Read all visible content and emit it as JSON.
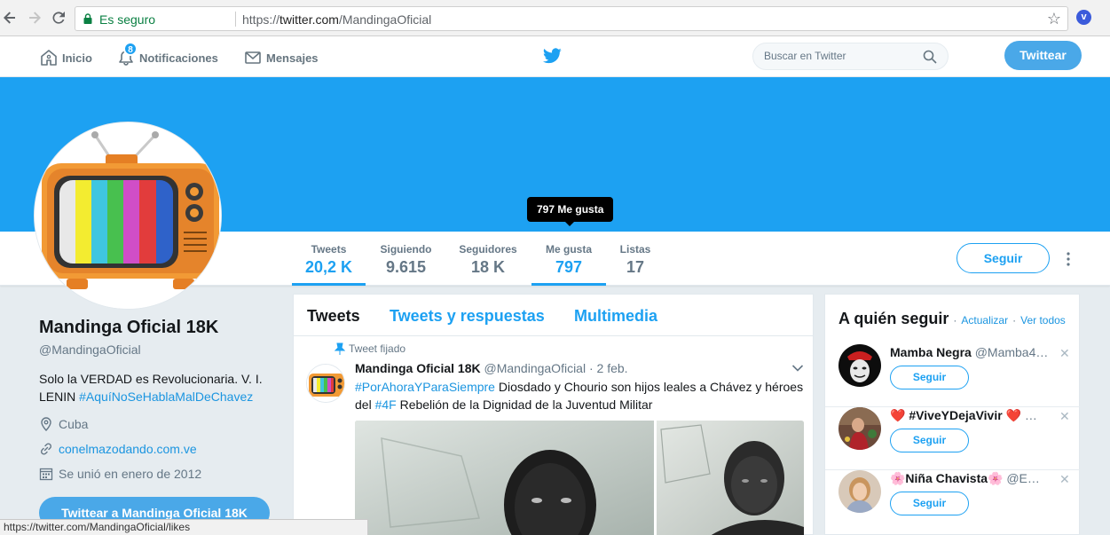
{
  "browser": {
    "secure_label": "Es seguro",
    "url_scheme": "https://",
    "url_host": "twitter.com",
    "url_path": "/MandingaOficial",
    "status_url": "https://twitter.com/MandingaOficial/likes",
    "ext_icon_letter": "v"
  },
  "nav": {
    "home": "Inicio",
    "notifications": "Notificaciones",
    "notifications_count": "8",
    "messages": "Mensajes",
    "search_placeholder": "Buscar en Twitter",
    "tweet_button": "Twittear"
  },
  "stats": [
    {
      "label": "Tweets",
      "value": "20,2 K"
    },
    {
      "label": "Siguiendo",
      "value": "9.615"
    },
    {
      "label": "Seguidores",
      "value": "18 K"
    },
    {
      "label": "Me gusta",
      "value": "797"
    },
    {
      "label": "Listas",
      "value": "17"
    }
  ],
  "tooltip": "797 Me gusta",
  "follow_button": "Seguir",
  "profile": {
    "name": "Mandinga Oficial 18K",
    "handle": "@MandingaOficial",
    "bio_text": "Solo la VERDAD es Revolucionaria. V. I. LENIN ",
    "bio_hashtag": "#AquíNoSeHablaMalDeChavez",
    "location": "Cuba",
    "website": "conelmazodando.com.ve",
    "joined": "Se unió en enero de 2012",
    "tweet_to_button": "Twittear a Mandinga Oficial 18K"
  },
  "timeline": {
    "tabs": [
      "Tweets",
      "Tweets y respuestas",
      "Multimedia"
    ],
    "pinned_label": "Tweet fijado",
    "tweet": {
      "name": "Mandinga Oficial 18K",
      "handle": "@MandingaOficial",
      "date": "· 2 feb.",
      "hashtag1": "#PorAhoraYParaSiempre",
      "text1": " Diosdado y Chourio son hijos leales a Chávez y héroes del ",
      "hashtag2": "#4F",
      "text2": " Rebelión de la Dignidad de la Juventud Militar"
    }
  },
  "who_to_follow": {
    "title": "A quién seguir",
    "dot": "·",
    "refresh": "Actualizar",
    "view_all": "Ver todos",
    "suggestions": [
      {
        "name": "Mamba Negra",
        "handle": "@Mamba4…",
        "button": "Seguir"
      },
      {
        "name": "❤️ #ViveYDejaVivir ❤️",
        "handle": "…",
        "button": "Seguir"
      },
      {
        "name": "🌸Niña Chavista🌸",
        "handle": "@E…",
        "button": "Seguir"
      }
    ]
  },
  "colors": {
    "brand": "#1da1f2",
    "link": "#1b95e0",
    "secure": "#0b8043"
  }
}
